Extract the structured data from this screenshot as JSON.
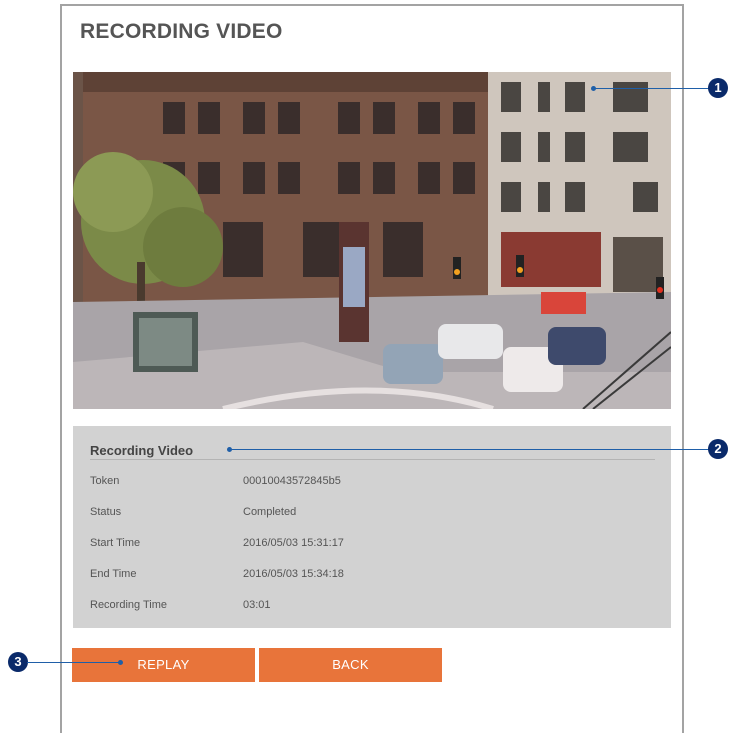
{
  "page": {
    "title": "RECORDING VIDEO"
  },
  "video": {
    "description_icon": "video-frame"
  },
  "info": {
    "title": "Recording Video",
    "rows": [
      {
        "label": "Token",
        "value": "00010043572845b5"
      },
      {
        "label": "Status",
        "value": "Completed"
      },
      {
        "label": "Start Time",
        "value": "2016/05/03 15:31:17"
      },
      {
        "label": "End Time",
        "value": "2016/05/03 15:34:18"
      },
      {
        "label": "Recording Time",
        "value": "03:01"
      }
    ]
  },
  "buttons": {
    "replay": "REPLAY",
    "back": "BACK"
  },
  "callouts": {
    "one": "1",
    "two": "2",
    "three": "3"
  },
  "colors": {
    "accent": "#e8743a",
    "panel": "#d2d2d2",
    "callout": "#0a2a6a"
  }
}
